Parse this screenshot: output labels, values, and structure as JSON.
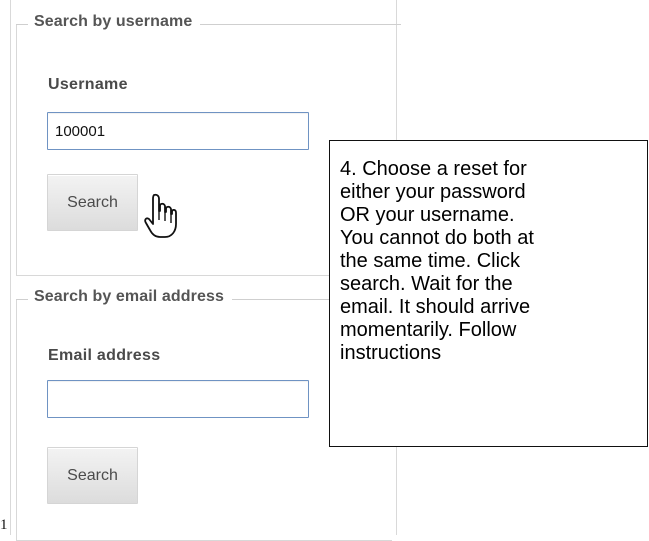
{
  "username_section": {
    "legend": "Search by username",
    "field_label": "Username",
    "input_value": "100001",
    "button_label": "Search"
  },
  "email_section": {
    "legend": "Search by email address",
    "field_label": "Email address",
    "input_value": "",
    "button_label": "Search"
  },
  "callout": {
    "text": "4. Choose a reset for\neither your password\nOR your username.\nYou cannot do both at\nthe same time. Click\nsearch. Wait for the\nemail. It should arrive\nmomentarily. Follow\ninstructions"
  },
  "page_marker": "1",
  "icons": {
    "cursor": "hand-pointer-icon"
  },
  "colors": {
    "input_border": "#6f93c3",
    "section_border": "#d8d8d8",
    "button_top": "#f3f3f3",
    "button_bottom": "#dcdcdc",
    "callout_border": "#111111"
  }
}
